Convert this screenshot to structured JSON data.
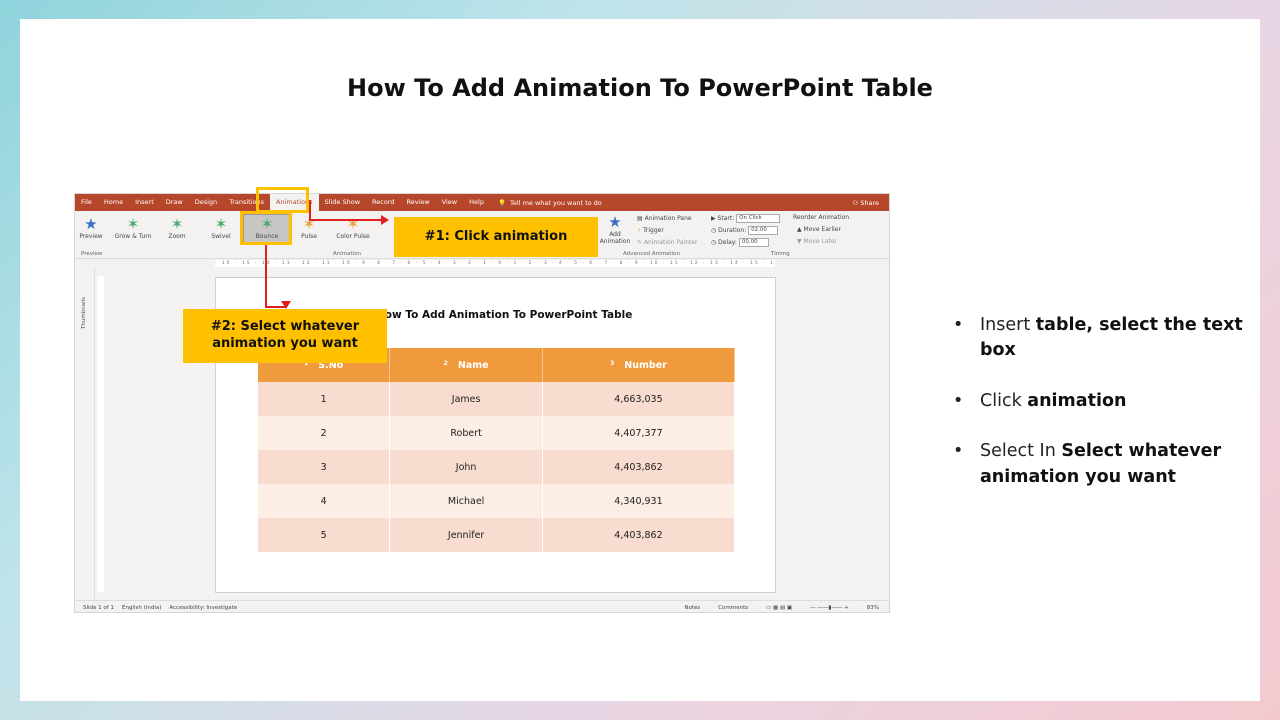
{
  "slide_title": "How To Add Animation To PowerPoint Table",
  "screenshot": {
    "tabs": [
      "File",
      "Home",
      "Insert",
      "Draw",
      "Design",
      "Transitions",
      "Animations",
      "Slide Show",
      "Record",
      "Review",
      "View",
      "Help"
    ],
    "active_tab": "Animations",
    "tell_me": "Tell me what you want to do",
    "share": "Share",
    "ribbon": {
      "preview": "Preview",
      "preview_group": "Preview",
      "animations": [
        {
          "label": "Grow & Turn",
          "color": "#4aa86b"
        },
        {
          "label": "Zoom",
          "color": "#4aa86b"
        },
        {
          "label": "Swivel",
          "color": "#4aa86b"
        },
        {
          "label": "Bounce",
          "color": "#4aa86b"
        },
        {
          "label": "Pulse",
          "color": "#e8a13a"
        },
        {
          "label": "Color Pulse",
          "color": "#e8a13a"
        }
      ],
      "animation_group": "Animation",
      "add_animation": "Add Animation",
      "animation_pane": "Animation Pane",
      "trigger": "Trigger",
      "animation_painter": "Animation Painter",
      "advanced_group": "Advanced Animation",
      "start_label": "Start:",
      "start_value": "On Click",
      "duration_label": "Duration:",
      "duration_value": "02.00",
      "delay_label": "Delay:",
      "delay_value": "00.00",
      "reorder": "Reorder Animation",
      "move_earlier": "Move Earlier",
      "move_later": "Move Later",
      "timing_group": "Timing"
    },
    "ruler_text": "· 16 · 15 · 14 · 13 · 12 · 11 · 10 · 9 · 8 · 7 · 6 · 5 · 4 · 3 · 2 · 1 · 0 · 1 · 2 · 3 · 4 · 5 · 6 · 7 · 8 · 9 · 10 · 11 · 12 · 13 · 14 · 15 · 16 ·",
    "thumbnails": "Thumbnails",
    "canvas_title": "How To Add Animation To PowerPoint Table",
    "table": {
      "headers": [
        {
          "icon": "1",
          "label": "S.No"
        },
        {
          "icon": "2",
          "label": "Name"
        },
        {
          "icon": "3",
          "label": "Number"
        }
      ],
      "rows": [
        [
          "1",
          "James",
          "4,663,035"
        ],
        [
          "2",
          "Robert",
          "4,407,377"
        ],
        [
          "3",
          "John",
          "4,403,862"
        ],
        [
          "4",
          "Michael",
          "4,340,931"
        ],
        [
          "5",
          "Jennifer",
          "4,403,862"
        ]
      ]
    },
    "status": {
      "slide": "Slide 1 of 1",
      "language": "English (India)",
      "accessibility": "Accessibility: Investigate",
      "notes": "Notes",
      "comments": "Comments",
      "zoom": "83%"
    }
  },
  "callouts": {
    "step1": "#1: Click animation",
    "step2_line1": "#2: Select whatever",
    "step2_line2": "animation you want",
    "accent": "#ffc000",
    "arrow": "#e02020"
  },
  "bullets": [
    {
      "normal": "Insert ",
      "bold": "table, select the text box"
    },
    {
      "normal": "Click ",
      "bold": "animation"
    },
    {
      "normal": "Select In  ",
      "bold": "Select whatever animation you want"
    }
  ]
}
